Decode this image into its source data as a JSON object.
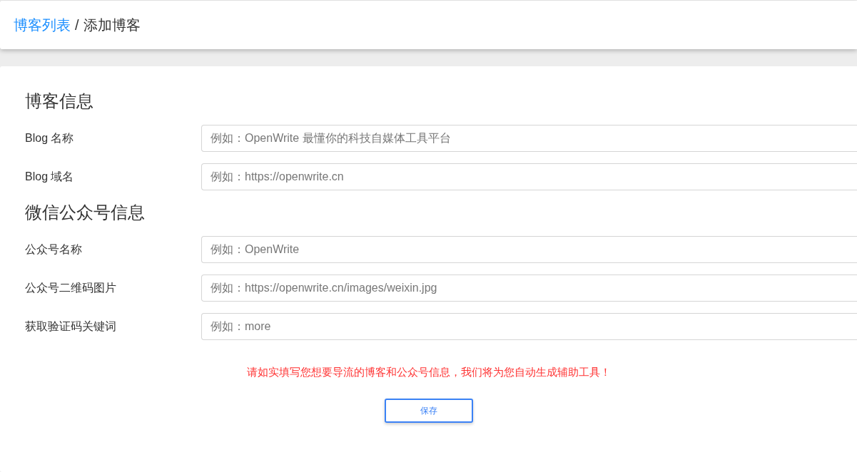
{
  "breadcrumb": {
    "link": "博客列表",
    "separator": "/",
    "current": "添加博客"
  },
  "sections": [
    {
      "title": "博客信息",
      "fields": [
        {
          "label": "Blog 名称",
          "placeholder": "例如：OpenWrite 最懂你的科技自媒体工具平台"
        },
        {
          "label": "Blog 域名",
          "placeholder": "例如：https://openwrite.cn"
        }
      ]
    },
    {
      "title": "微信公众号信息",
      "fields": [
        {
          "label": "公众号名称",
          "placeholder": "例如：OpenWrite"
        },
        {
          "label": "公众号二维码图片",
          "placeholder": "例如：https://openwrite.cn/images/weixin.jpg"
        },
        {
          "label": "获取验证码关键词",
          "placeholder": "例如：more"
        }
      ]
    }
  ],
  "notice": "请如实填写您想要导流的博客和公众号信息，我们将为您自动生成辅助工具！",
  "save_button": "保存"
}
